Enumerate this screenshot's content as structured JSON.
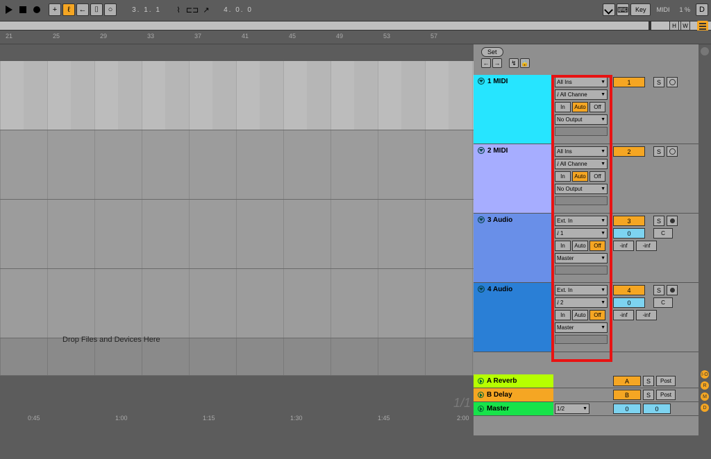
{
  "transport": {
    "position": "3. 1. 1",
    "loop": "4. 0. 0",
    "key_label": "Key",
    "midi_label": "MIDI",
    "midi_pct": "1 %",
    "d_label": "D",
    "h_label": "H",
    "w_label": "W"
  },
  "ruler_bars": [
    "21",
    "25",
    "29",
    "33",
    "37",
    "41",
    "45",
    "49",
    "53",
    "57"
  ],
  "set_label": "Set",
  "tracks": [
    {
      "name": "1 MIDI",
      "color": "c-cyan",
      "in": "All Ins",
      "ch": "All Channe",
      "mon": [
        "In",
        "Auto",
        "Off"
      ],
      "mon_on": 1,
      "out": "No Output",
      "num": "1",
      "solo": "S",
      "arm": "ring",
      "sends": null,
      "pan": null
    },
    {
      "name": "2 MIDI",
      "color": "c-lav",
      "in": "All Ins",
      "ch": "All Channe",
      "mon": [
        "In",
        "Auto",
        "Off"
      ],
      "mon_on": 1,
      "out": "No Output",
      "num": "2",
      "solo": "S",
      "arm": "ring",
      "sends": null,
      "pan": null
    },
    {
      "name": "3 Audio",
      "color": "c-blue",
      "in": "Ext. In",
      "ch": "1",
      "mon": [
        "In",
        "Auto",
        "Off"
      ],
      "mon_on": 2,
      "out": "Master",
      "num": "3",
      "solo": "S",
      "arm": "dot",
      "sends": [
        "-inf",
        "-inf"
      ],
      "pan": "0",
      "pan_label": "C"
    },
    {
      "name": "4 Audio",
      "color": "c-dblue",
      "in": "Ext. In",
      "ch": "2",
      "mon": [
        "In",
        "Auto",
        "Off"
      ],
      "mon_on": 2,
      "out": "Master",
      "num": "4",
      "solo": "S",
      "arm": "dot",
      "sends": [
        "-inf",
        "-inf"
      ],
      "pan": "0",
      "pan_label": "C"
    }
  ],
  "returns": [
    {
      "name": "A Reverb",
      "color": "c-lime",
      "letter": "A",
      "solo": "S",
      "post": "Post"
    },
    {
      "name": "B Delay",
      "color": "c-orange",
      "letter": "B",
      "solo": "S",
      "post": "Post"
    }
  ],
  "master": {
    "name": "Master",
    "color": "c-green",
    "cue": "1/2",
    "vol": "0",
    "vol2": "0"
  },
  "gutter": [
    "I·O",
    "R",
    "M",
    "D"
  ],
  "drop_hint": "Drop Files and Devices Here",
  "fraction": "1/1",
  "btm_times": [
    "0:45",
    "1:00",
    "1:15",
    "1:30",
    "1:45",
    "2:00"
  ]
}
